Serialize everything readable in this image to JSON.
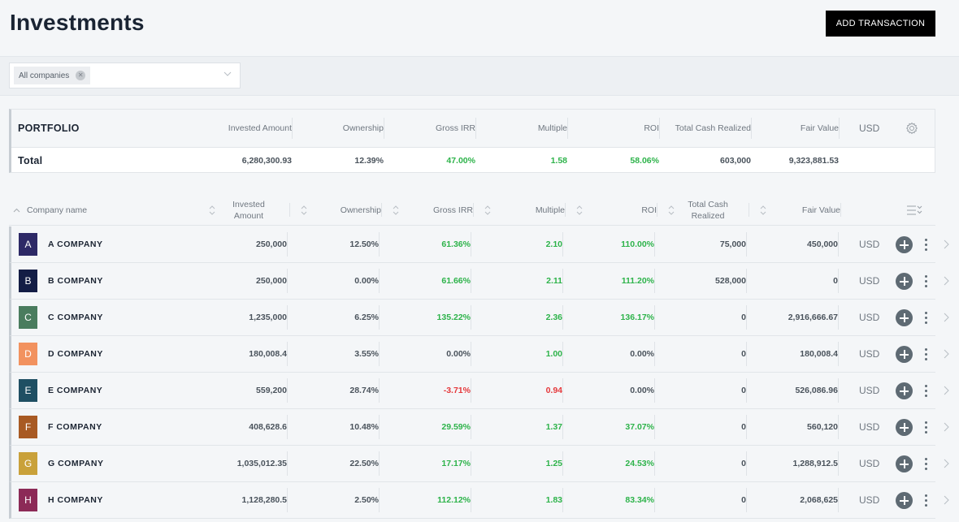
{
  "header": {
    "title": "Investments",
    "add_button": "ADD TRANSACTION"
  },
  "filter": {
    "chip_label": "All companies",
    "chip_remove_icon": "close-icon",
    "dropdown_icon": "chevron-down-icon"
  },
  "portfolio": {
    "label": "PORTFOLIO",
    "columns": [
      "Invested Amount",
      "Ownership",
      "Gross IRR",
      "Multiple",
      "ROI",
      "Total Cash Realized",
      "Fair Value"
    ],
    "currency": "USD",
    "settings_icon": "gear-icon",
    "total": {
      "label": "Total",
      "invested": "6,280,300.93",
      "ownership": "12.39%",
      "gross_irr": "47.00%",
      "multiple": "1.58",
      "roi": "58.06%",
      "cash_realized": "603,000",
      "fair_value": "9,323,881.53"
    }
  },
  "table": {
    "headers": {
      "company": "Company name",
      "invested_1": "Invested",
      "invested_2": "Amount",
      "ownership": "Ownership",
      "gross_irr": "Gross IRR",
      "multiple": "Multiple",
      "roi": "ROI",
      "cash_1": "Total Cash",
      "cash_2": "Realized",
      "fair_value": "Fair Value"
    },
    "rows": [
      {
        "initial": "A",
        "name": "A COMPANY",
        "color": "#2d2966",
        "invested": "250,000",
        "ownership": "12.50%",
        "gross_irr": "61.36%",
        "irr_status": "positive",
        "multiple": "2.10",
        "multiple_status": "positive",
        "roi": "110.00%",
        "roi_status": "positive",
        "cash_realized": "75,000",
        "fair_value": "450,000",
        "currency": "USD"
      },
      {
        "initial": "B",
        "name": "B COMPANY",
        "color": "#131d45",
        "invested": "250,000",
        "ownership": "0.00%",
        "gross_irr": "61.66%",
        "irr_status": "positive",
        "multiple": "2.11",
        "multiple_status": "positive",
        "roi": "111.20%",
        "roi_status": "positive",
        "cash_realized": "528,000",
        "fair_value": "0",
        "currency": "USD"
      },
      {
        "initial": "C",
        "name": "C COMPANY",
        "color": "#4a7c5e",
        "invested": "1,235,000",
        "ownership": "6.25%",
        "gross_irr": "135.22%",
        "irr_status": "positive",
        "multiple": "2.36",
        "multiple_status": "positive",
        "roi": "136.17%",
        "roi_status": "positive",
        "cash_realized": "0",
        "fair_value": "2,916,666.67",
        "currency": "USD"
      },
      {
        "initial": "D",
        "name": "D COMPANY",
        "color": "#f2925f",
        "invested": "180,008.4",
        "ownership": "3.55%",
        "gross_irr": "0.00%",
        "irr_status": "neutral",
        "multiple": "1.00",
        "multiple_status": "positive",
        "roi": "0.00%",
        "roi_status": "neutral",
        "cash_realized": "0",
        "fair_value": "180,008.4",
        "currency": "USD"
      },
      {
        "initial": "E",
        "name": "E COMPANY",
        "color": "#1f4f63",
        "invested": "559,200",
        "ownership": "28.74%",
        "gross_irr": "-3.71%",
        "irr_status": "negative",
        "multiple": "0.94",
        "multiple_status": "negative",
        "roi": "0.00%",
        "roi_status": "neutral",
        "cash_realized": "0",
        "fair_value": "526,086.96",
        "currency": "USD"
      },
      {
        "initial": "F",
        "name": "F COMPANY",
        "color": "#a85a23",
        "invested": "408,628.6",
        "ownership": "10.48%",
        "gross_irr": "29.59%",
        "irr_status": "positive",
        "multiple": "1.37",
        "multiple_status": "positive",
        "roi": "37.07%",
        "roi_status": "positive",
        "cash_realized": "0",
        "fair_value": "560,120",
        "currency": "USD"
      },
      {
        "initial": "G",
        "name": "G COMPANY",
        "color": "#c9a13a",
        "invested": "1,035,012.35",
        "ownership": "22.50%",
        "gross_irr": "17.17%",
        "irr_status": "positive",
        "multiple": "1.25",
        "multiple_status": "positive",
        "roi": "24.53%",
        "roi_status": "positive",
        "cash_realized": "0",
        "fair_value": "1,288,912.5",
        "currency": "USD"
      },
      {
        "initial": "H",
        "name": "H COMPANY",
        "color": "#8c2a57",
        "invested": "1,128,280.5",
        "ownership": "2.50%",
        "gross_irr": "112.12%",
        "irr_status": "positive",
        "multiple": "1.83",
        "multiple_status": "positive",
        "roi": "83.34%",
        "roi_status": "positive",
        "cash_realized": "0",
        "fair_value": "2,068,625",
        "currency": "USD"
      }
    ]
  },
  "colors": {
    "positive": "#2db34a",
    "negative": "#e5383b",
    "button_bg": "#000000"
  }
}
